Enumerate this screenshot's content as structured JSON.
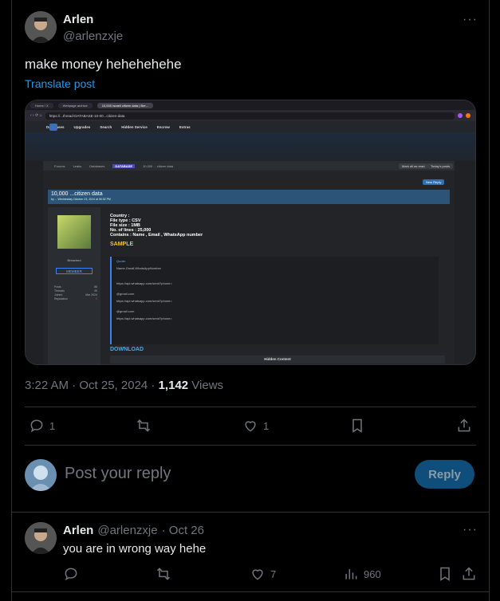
{
  "post": {
    "author_name": "Arlen",
    "author_handle": "@arlenzxje",
    "text": "make money hehehehehe",
    "translate_label": "Translate post",
    "time": "3:22 AM · Oct 25, 2024 · ",
    "views_count": "1,142",
    "views_label": " Views",
    "actions": {
      "reply_count": "1",
      "repost_count": "",
      "like_count": "1"
    }
  },
  "media": {
    "tabs": [
      "Home / X",
      "Webpage archive",
      "10,000 Israeli citizen data | Bre..."
    ],
    "url": "https://...thread-DATABASE-10-00...citizen-data",
    "nav_items": [
      "Databases",
      "Upgrades",
      "Search",
      "Hidden Service",
      "Escrow",
      "Extras"
    ],
    "crumbs": [
      "Forums",
      "Leaks",
      "Databases"
    ],
    "crumb_tag": "DATABASE",
    "crumb_tail": "10,000 ... citizen data",
    "mark_read": "Mark all as read",
    "todays_posts": "Today's posts",
    "new_reply": "New Reply",
    "thread_title": "10,000 ...citizen data",
    "thread_sub": "by ... Wednesday October 23, 2024 at 06:32 PM",
    "user_rank": "Breached",
    "user_badge": "MEMBER",
    "user_stats": [
      {
        "k": "Posts",
        "v": "85"
      },
      {
        "k": "Threads",
        "v": "49"
      },
      {
        "k": "Joined",
        "v": "Mar 2024"
      },
      {
        "k": "Reputation",
        "v": "0"
      }
    ],
    "content_lines": [
      "Country :",
      "File type : CSV",
      "File size : 1MB",
      "No. of lines : 25,000",
      "Contains : Name , Email , WhatsApp number"
    ],
    "sample_label": "SAMPLE",
    "quote_label": "Quote:",
    "quote_lines": [
      "Name,Gmail,WhatsAppNumber",
      "https://api.whatsapp.com/send?phone=",
      "@gmail.com",
      "https://api.whatsapp.com/send?phone=",
      "@gmail.com",
      "https://api.whatsapp.com/send?phone="
    ],
    "download_label": "DOWNLOAD",
    "hidden_label": "Hidden Content"
  },
  "reply_box": {
    "placeholder": "Post your reply",
    "button": "Reply"
  },
  "comment": {
    "author_name": "Arlen",
    "author_handle": "@arlenzxje",
    "date": "· Oct 26",
    "text": "you are in wrong way hehe",
    "like_count": "7",
    "view_count": "960"
  },
  "colors": {
    "accent": "#1d9bf0",
    "muted": "#71767b",
    "border": "#2f3336"
  }
}
